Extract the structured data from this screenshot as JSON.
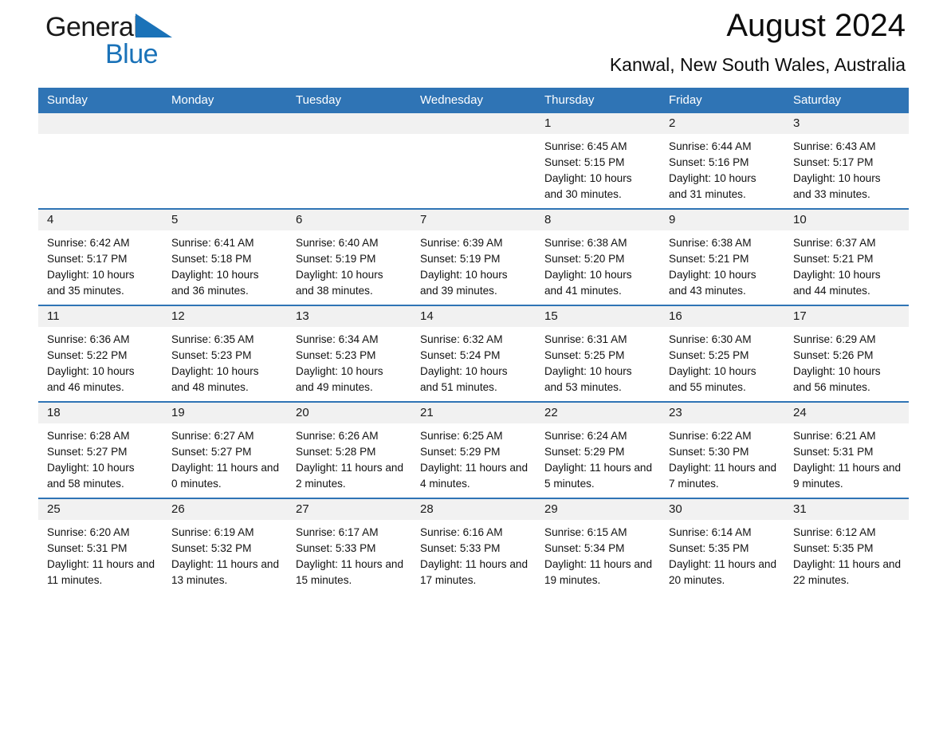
{
  "brand": {
    "name_part1": "General",
    "name_part2": "Blue",
    "triangle_color": "#1a72b8"
  },
  "header": {
    "month_title": "August 2024",
    "location": "Kanwal, New South Wales, Australia",
    "accent_color": "#2f74b5",
    "daynum_band_color": "#f1f1f1"
  },
  "weekday_headers": [
    "Sunday",
    "Monday",
    "Tuesday",
    "Wednesday",
    "Thursday",
    "Friday",
    "Saturday"
  ],
  "labels": {
    "sunrise_prefix": "Sunrise:",
    "sunset_prefix": "Sunset:",
    "daylight_prefix": "Daylight:"
  },
  "weeks": [
    [
      {
        "day": "",
        "empty": true
      },
      {
        "day": "",
        "empty": true
      },
      {
        "day": "",
        "empty": true
      },
      {
        "day": "",
        "empty": true
      },
      {
        "day": "1",
        "sunrise": "Sunrise: 6:45 AM",
        "sunset": "Sunset: 5:15 PM",
        "daylight": "Daylight: 10 hours and 30 minutes."
      },
      {
        "day": "2",
        "sunrise": "Sunrise: 6:44 AM",
        "sunset": "Sunset: 5:16 PM",
        "daylight": "Daylight: 10 hours and 31 minutes."
      },
      {
        "day": "3",
        "sunrise": "Sunrise: 6:43 AM",
        "sunset": "Sunset: 5:17 PM",
        "daylight": "Daylight: 10 hours and 33 minutes."
      }
    ],
    [
      {
        "day": "4",
        "sunrise": "Sunrise: 6:42 AM",
        "sunset": "Sunset: 5:17 PM",
        "daylight": "Daylight: 10 hours and 35 minutes."
      },
      {
        "day": "5",
        "sunrise": "Sunrise: 6:41 AM",
        "sunset": "Sunset: 5:18 PM",
        "daylight": "Daylight: 10 hours and 36 minutes."
      },
      {
        "day": "6",
        "sunrise": "Sunrise: 6:40 AM",
        "sunset": "Sunset: 5:19 PM",
        "daylight": "Daylight: 10 hours and 38 minutes."
      },
      {
        "day": "7",
        "sunrise": "Sunrise: 6:39 AM",
        "sunset": "Sunset: 5:19 PM",
        "daylight": "Daylight: 10 hours and 39 minutes."
      },
      {
        "day": "8",
        "sunrise": "Sunrise: 6:38 AM",
        "sunset": "Sunset: 5:20 PM",
        "daylight": "Daylight: 10 hours and 41 minutes."
      },
      {
        "day": "9",
        "sunrise": "Sunrise: 6:38 AM",
        "sunset": "Sunset: 5:21 PM",
        "daylight": "Daylight: 10 hours and 43 minutes."
      },
      {
        "day": "10",
        "sunrise": "Sunrise: 6:37 AM",
        "sunset": "Sunset: 5:21 PM",
        "daylight": "Daylight: 10 hours and 44 minutes."
      }
    ],
    [
      {
        "day": "11",
        "sunrise": "Sunrise: 6:36 AM",
        "sunset": "Sunset: 5:22 PM",
        "daylight": "Daylight: 10 hours and 46 minutes."
      },
      {
        "day": "12",
        "sunrise": "Sunrise: 6:35 AM",
        "sunset": "Sunset: 5:23 PM",
        "daylight": "Daylight: 10 hours and 48 minutes."
      },
      {
        "day": "13",
        "sunrise": "Sunrise: 6:34 AM",
        "sunset": "Sunset: 5:23 PM",
        "daylight": "Daylight: 10 hours and 49 minutes."
      },
      {
        "day": "14",
        "sunrise": "Sunrise: 6:32 AM",
        "sunset": "Sunset: 5:24 PM",
        "daylight": "Daylight: 10 hours and 51 minutes."
      },
      {
        "day": "15",
        "sunrise": "Sunrise: 6:31 AM",
        "sunset": "Sunset: 5:25 PM",
        "daylight": "Daylight: 10 hours and 53 minutes."
      },
      {
        "day": "16",
        "sunrise": "Sunrise: 6:30 AM",
        "sunset": "Sunset: 5:25 PM",
        "daylight": "Daylight: 10 hours and 55 minutes."
      },
      {
        "day": "17",
        "sunrise": "Sunrise: 6:29 AM",
        "sunset": "Sunset: 5:26 PM",
        "daylight": "Daylight: 10 hours and 56 minutes."
      }
    ],
    [
      {
        "day": "18",
        "sunrise": "Sunrise: 6:28 AM",
        "sunset": "Sunset: 5:27 PM",
        "daylight": "Daylight: 10 hours and 58 minutes."
      },
      {
        "day": "19",
        "sunrise": "Sunrise: 6:27 AM",
        "sunset": "Sunset: 5:27 PM",
        "daylight": "Daylight: 11 hours and 0 minutes."
      },
      {
        "day": "20",
        "sunrise": "Sunrise: 6:26 AM",
        "sunset": "Sunset: 5:28 PM",
        "daylight": "Daylight: 11 hours and 2 minutes."
      },
      {
        "day": "21",
        "sunrise": "Sunrise: 6:25 AM",
        "sunset": "Sunset: 5:29 PM",
        "daylight": "Daylight: 11 hours and 4 minutes."
      },
      {
        "day": "22",
        "sunrise": "Sunrise: 6:24 AM",
        "sunset": "Sunset: 5:29 PM",
        "daylight": "Daylight: 11 hours and 5 minutes."
      },
      {
        "day": "23",
        "sunrise": "Sunrise: 6:22 AM",
        "sunset": "Sunset: 5:30 PM",
        "daylight": "Daylight: 11 hours and 7 minutes."
      },
      {
        "day": "24",
        "sunrise": "Sunrise: 6:21 AM",
        "sunset": "Sunset: 5:31 PM",
        "daylight": "Daylight: 11 hours and 9 minutes."
      }
    ],
    [
      {
        "day": "25",
        "sunrise": "Sunrise: 6:20 AM",
        "sunset": "Sunset: 5:31 PM",
        "daylight": "Daylight: 11 hours and 11 minutes."
      },
      {
        "day": "26",
        "sunrise": "Sunrise: 6:19 AM",
        "sunset": "Sunset: 5:32 PM",
        "daylight": "Daylight: 11 hours and 13 minutes."
      },
      {
        "day": "27",
        "sunrise": "Sunrise: 6:17 AM",
        "sunset": "Sunset: 5:33 PM",
        "daylight": "Daylight: 11 hours and 15 minutes."
      },
      {
        "day": "28",
        "sunrise": "Sunrise: 6:16 AM",
        "sunset": "Sunset: 5:33 PM",
        "daylight": "Daylight: 11 hours and 17 minutes."
      },
      {
        "day": "29",
        "sunrise": "Sunrise: 6:15 AM",
        "sunset": "Sunset: 5:34 PM",
        "daylight": "Daylight: 11 hours and 19 minutes."
      },
      {
        "day": "30",
        "sunrise": "Sunrise: 6:14 AM",
        "sunset": "Sunset: 5:35 PM",
        "daylight": "Daylight: 11 hours and 20 minutes."
      },
      {
        "day": "31",
        "sunrise": "Sunrise: 6:12 AM",
        "sunset": "Sunset: 5:35 PM",
        "daylight": "Daylight: 11 hours and 22 minutes."
      }
    ]
  ]
}
